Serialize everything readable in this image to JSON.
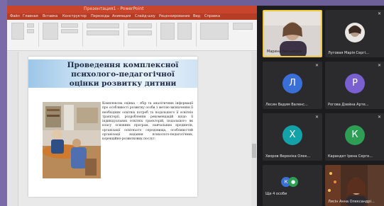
{
  "ppt": {
    "window_title": "Презентация1 - PowerPoint",
    "tabs": [
      "Файл",
      "Главная",
      "Вставка",
      "Конструктор",
      "Переходы",
      "Анимация",
      "Слайд-шоу",
      "Рецензирование",
      "Вид",
      "Справка"
    ],
    "ribbon_right_label": "Показать",
    "status": ""
  },
  "slide": {
    "title": "Проведення комплексної психолого-педагогічної оцінки розвитку дитини",
    "body": "Комплексна оцінка – збір та аналітичних інформації про особливості розвитку особи з метою визначення її необхідних освітніх потреб та подальшого її освітніх траєкторії, розроблення рекомендацій щодо її індивідуальних освітніх траєкторій, подальшого як класу основних програм, навчальних предметів, організації освітнього середовища, особливостей організації надання психолого-педагогічних, корекційно-розвиткових послуг."
  },
  "participants": [
    {
      "name": "Марина Бельведон",
      "type": "video",
      "active": true
    },
    {
      "name": "Луговая Марія Сергі...",
      "type": "video",
      "active": false
    },
    {
      "name": "Лесин Вадим Валенс...",
      "type": "avatar",
      "initial": "Л",
      "color": "#3a6fd8"
    },
    {
      "name": "Рогова Дзейна Арте...",
      "type": "avatar",
      "initial": "Р",
      "color": "#7a5fd0"
    },
    {
      "name": "Хворов Вероніка Олек...",
      "type": "avatar",
      "initial": "Х",
      "color": "#13a2a8"
    },
    {
      "name": "Карандет Ірена Серге...",
      "type": "avatar",
      "initial": "К",
      "color": "#2e9e55"
    },
    {
      "name": "Ще 4 особи",
      "type": "more"
    },
    {
      "name": "Лисін Анна Олександрі...",
      "type": "video",
      "active": false
    }
  ],
  "colors": {
    "ppt_accent": "#c8442a",
    "tile_bg": "#2b2b2e",
    "active_speaker": "#f0c93a"
  }
}
